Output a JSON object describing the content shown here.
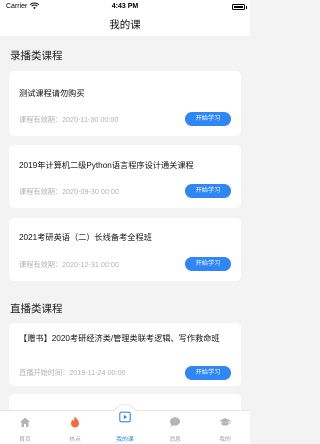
{
  "status_bar": {
    "carrier": "Carrier",
    "time": "4:43 PM"
  },
  "nav": {
    "title": "我的课"
  },
  "sections": {
    "recorded": "录播类课程",
    "live": "直播类课程"
  },
  "courses": [
    {
      "title": "测试课程请勿购买",
      "date": "课程有效期：2020-11-30 00:00",
      "button": "开始学习"
    },
    {
      "title": "2019年计算机二级Python语言程序设计通关课程",
      "date": "课程有效期：2020-09-30 00:00",
      "button": "开始学习"
    },
    {
      "title": "2021考研英语（二）长线备考全程班",
      "date": "课程有效期：2020-12-31 00:00",
      "button": "开始学习"
    },
    {
      "title": "【赠书】2020考研经济类/管理类联考逻辑、写作救命班",
      "date": "直播开始时间：2019-11-24 00:00",
      "button": "开始学习"
    }
  ],
  "tabs": [
    {
      "label": "首页",
      "icon": "home-icon"
    },
    {
      "label": "热点",
      "icon": "flame-icon"
    },
    {
      "label": "我的课",
      "icon": "play-icon"
    },
    {
      "label": "消息",
      "icon": "chat-icon"
    },
    {
      "label": "我的",
      "icon": "graduation-cap-icon"
    }
  ],
  "colors": {
    "accent": "#2f86f6",
    "hot": "#f46a3a",
    "background": "#f3f3f3"
  }
}
